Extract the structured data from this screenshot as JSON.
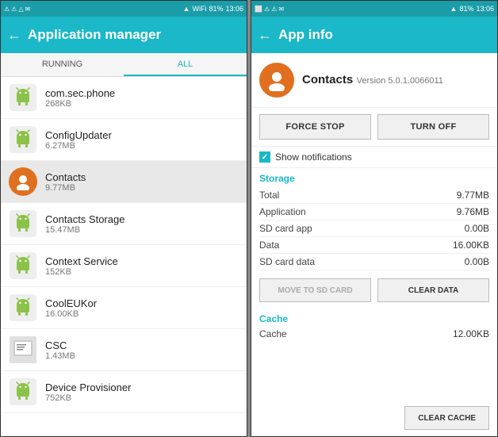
{
  "left_panel": {
    "status_bar": {
      "left_icons": [
        "⚠",
        "⚠",
        "△"
      ],
      "time": "13:06",
      "right_icons": [
        "📶",
        "81%",
        "🔋"
      ]
    },
    "header": {
      "back_label": "←",
      "title": "Application manager"
    },
    "tabs": [
      {
        "label": "RUNNING",
        "active": false
      },
      {
        "label": "ALL",
        "active": true
      }
    ],
    "apps": [
      {
        "name": "com.sec.phone",
        "size": "268KB",
        "selected": false
      },
      {
        "name": "ConfigUpdater",
        "size": "6.27MB",
        "selected": false
      },
      {
        "name": "Contacts",
        "size": "9.77MB",
        "selected": true
      },
      {
        "name": "Contacts Storage",
        "size": "15.47MB",
        "selected": false
      },
      {
        "name": "Context Service",
        "size": "152KB",
        "selected": false
      },
      {
        "name": "CoolEUKor",
        "size": "16.00KB",
        "selected": false
      },
      {
        "name": "CSC",
        "size": "1.43MB",
        "selected": false
      },
      {
        "name": "Device Provisioner",
        "size": "752KB",
        "selected": false
      }
    ]
  },
  "right_panel": {
    "status_bar": {
      "time": "13:06",
      "right_icons": [
        "📶",
        "81%",
        "🔋"
      ]
    },
    "header": {
      "back_label": "←",
      "title": "App info"
    },
    "app": {
      "name": "Contacts",
      "version": "Version 5.0.1.0066011"
    },
    "buttons": {
      "force_stop": "FORCE STOP",
      "turn_off": "TURN OFF"
    },
    "notifications": {
      "label": "Show notifications",
      "checked": true
    },
    "storage": {
      "section_title": "Storage",
      "rows": [
        {
          "label": "Total",
          "value": "9.77MB"
        },
        {
          "label": "Application",
          "value": "9.76MB"
        },
        {
          "label": "SD card app",
          "value": "0.00B"
        },
        {
          "label": "Data",
          "value": "16.00KB"
        },
        {
          "label": "SD card data",
          "value": "0.00B"
        }
      ],
      "move_btn": "MOVE TO SD CARD",
      "clear_data_btn": "CLEAR DATA"
    },
    "cache": {
      "section_title": "Cache",
      "rows": [
        {
          "label": "Cache",
          "value": "12.00KB"
        }
      ],
      "clear_cache_btn": "CLEAR CACHE"
    }
  }
}
